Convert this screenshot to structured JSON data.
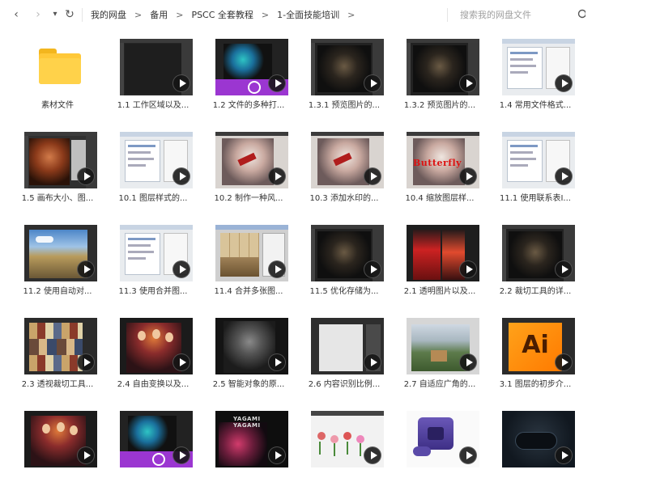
{
  "toolbar": {
    "back_label": "‹",
    "forward_label": "›",
    "history_label": "▾",
    "refresh_label": "↻"
  },
  "breadcrumb": {
    "items": [
      "我的网盘",
      "备用",
      "PSCC 全套教程",
      "1-全面技能培训"
    ],
    "separator": ">"
  },
  "search": {
    "placeholder": "搜索我的网盘文件"
  },
  "grid": {
    "items": [
      {
        "label": "素材文件",
        "kind": "folder"
      },
      {
        "label": "1.1 工作区域以及...",
        "kind": "video",
        "thumb": "ps-dark"
      },
      {
        "label": "1.2 文件的多种打...",
        "kind": "video",
        "thumb": "ps-splash"
      },
      {
        "label": "1.3.1 预览图片的...",
        "kind": "video",
        "thumb": "ps-dark-photo"
      },
      {
        "label": "1.3.2 预览图片的...",
        "kind": "video",
        "thumb": "ps-dark-photo"
      },
      {
        "label": "1.4 常用文件格式...",
        "kind": "video",
        "thumb": "dialog-light"
      },
      {
        "label": "1.5 画布大小、图...",
        "kind": "video",
        "thumb": "ps-portrait"
      },
      {
        "label": "10.1 图层样式的...",
        "kind": "video",
        "thumb": "dialog-light"
      },
      {
        "label": "10.2 制作一种风...",
        "kind": "video",
        "thumb": "ps-anime"
      },
      {
        "label": "10.3 添加水印的...",
        "kind": "video",
        "thumb": "ps-anime"
      },
      {
        "label": "10.4 缩放图层样...",
        "kind": "video",
        "thumb": "ps-butterfly",
        "text": "Butterfly"
      },
      {
        "label": "11.1 使用联系表I...",
        "kind": "video",
        "thumb": "dialog-light"
      },
      {
        "label": "11.2 使用自动对...",
        "kind": "video",
        "thumb": "ps-landscape"
      },
      {
        "label": "11.3 使用合并图...",
        "kind": "video",
        "thumb": "dialog-light"
      },
      {
        "label": "11.4 合并多张图...",
        "kind": "video",
        "thumb": "ps-tiles"
      },
      {
        "label": "11.5 优化存储为...",
        "kind": "video",
        "thumb": "ps-dark-photo"
      },
      {
        "label": "2.1 透明图片以及...",
        "kind": "video",
        "thumb": "ps-red"
      },
      {
        "label": "2.2 裁切工具的详...",
        "kind": "video",
        "thumb": "ps-dark-photo"
      },
      {
        "label": "2.3 透视裁切工具...",
        "kind": "video",
        "thumb": "ps-collage"
      },
      {
        "label": "2.4 自由变换以及...",
        "kind": "video",
        "thumb": "ps-group"
      },
      {
        "label": "2.5 智能对象的原...",
        "kind": "video",
        "thumb": "ps-muscle"
      },
      {
        "label": "2.6 内容识别比例...",
        "kind": "video",
        "thumb": "ps-blank"
      },
      {
        "label": "2.7 自适应广角的...",
        "kind": "video",
        "thumb": "ps-garden"
      },
      {
        "label": "3.1 图层的初步介...",
        "kind": "video",
        "thumb": "ps-ai",
        "text": "Ai"
      },
      {
        "label": "",
        "kind": "video",
        "thumb": "ps-group"
      },
      {
        "label": "",
        "kind": "video",
        "thumb": "ps-splash"
      },
      {
        "label": "",
        "kind": "video",
        "thumb": "ps-yagami",
        "text": "YAGAMI"
      },
      {
        "label": "",
        "kind": "video",
        "thumb": "ps-flowers"
      },
      {
        "label": "",
        "kind": "video",
        "thumb": "ps-console"
      },
      {
        "label": "",
        "kind": "video",
        "thumb": "ps-gamepad"
      }
    ]
  },
  "colors": {
    "folder": "#ffc838",
    "accent": "#9b36d1",
    "text": "#333333"
  }
}
